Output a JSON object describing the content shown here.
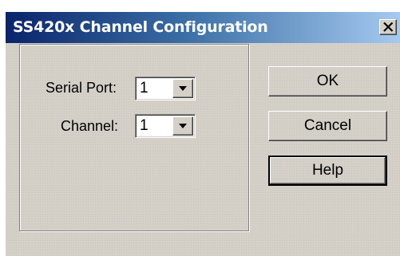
{
  "window": {
    "title": "SS420x Channel Configuration",
    "close_glyph": "✕"
  },
  "form": {
    "serial_port_label": "Serial Port:",
    "serial_port_value": "1",
    "channel_label": "Channel:",
    "channel_value": "1"
  },
  "buttons": {
    "ok": "OK",
    "cancel": "Cancel",
    "help": "Help"
  },
  "icons": {
    "close": "close-icon",
    "dropdown": "chevron-down-icon"
  },
  "colors": {
    "title_start": "#0a246a",
    "title_end": "#a6caf0",
    "face": "#d4d0c8"
  }
}
